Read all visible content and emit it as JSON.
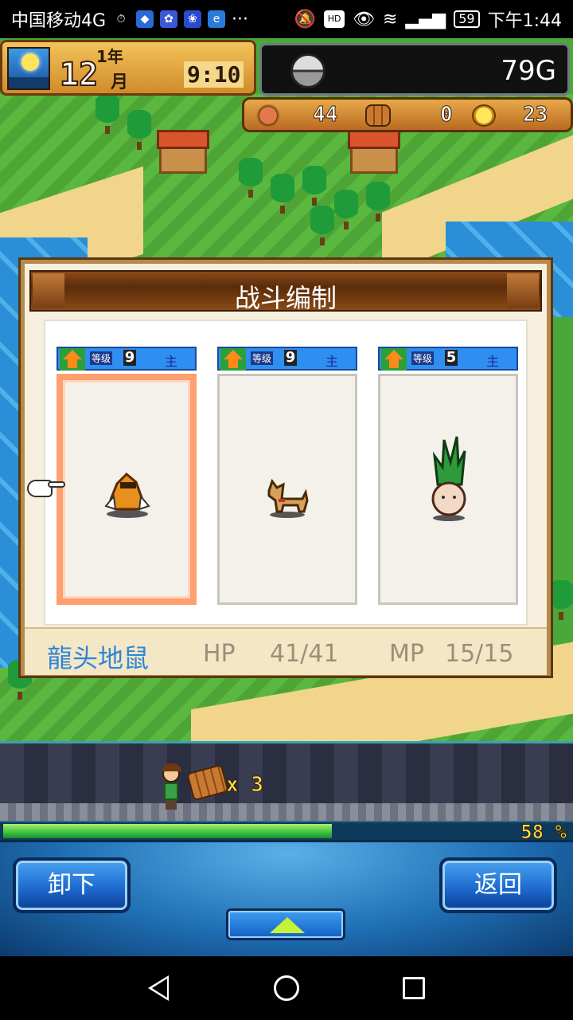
{
  "statusbar": {
    "carrier": "中国移动4G",
    "time": "下午1:44",
    "battery": "59",
    "icons": [
      "alarm-icon",
      "shield-icon",
      "paw-icon",
      "baidu-icon",
      "ie-icon",
      "more-icon",
      "mute-icon",
      "hd-icon",
      "eye-icon",
      "wifi-icon",
      "signal-icon",
      "battery-icon"
    ]
  },
  "hud": {
    "year": "1年",
    "day": "12",
    "month": "月",
    "time": "9:10",
    "gold": "79G",
    "resources": [
      {
        "name": "meat-icon",
        "value": "44"
      },
      {
        "name": "wood-icon",
        "value": "0"
      },
      {
        "name": "coin-icon",
        "value": "23"
      }
    ]
  },
  "panel": {
    "title": "战斗编制",
    "cards": [
      {
        "level_label": "等级",
        "level": "9",
        "role": "主",
        "monster": "orange-mole-monster",
        "selected": true
      },
      {
        "level_label": "等级",
        "level": "9",
        "role": "主",
        "monster": "dog-monster",
        "selected": false
      },
      {
        "level_label": "等级",
        "level": "5",
        "role": "主",
        "monster": "plant-monster",
        "selected": false
      }
    ],
    "info": {
      "name": "龍头地鼠",
      "hp_label": "HP",
      "hp": "41/41",
      "mp_label": "MP",
      "mp": "15/15"
    }
  },
  "work": {
    "log_count": "x 3",
    "progress_text": "58 %",
    "progress": 0.58
  },
  "controls": {
    "left_button": "卸下",
    "right_button": "返回"
  },
  "colors": {
    "accent_blue": "#2e86d8",
    "selected_border": "#ff9e6e",
    "progress_green": "#3ac040"
  }
}
